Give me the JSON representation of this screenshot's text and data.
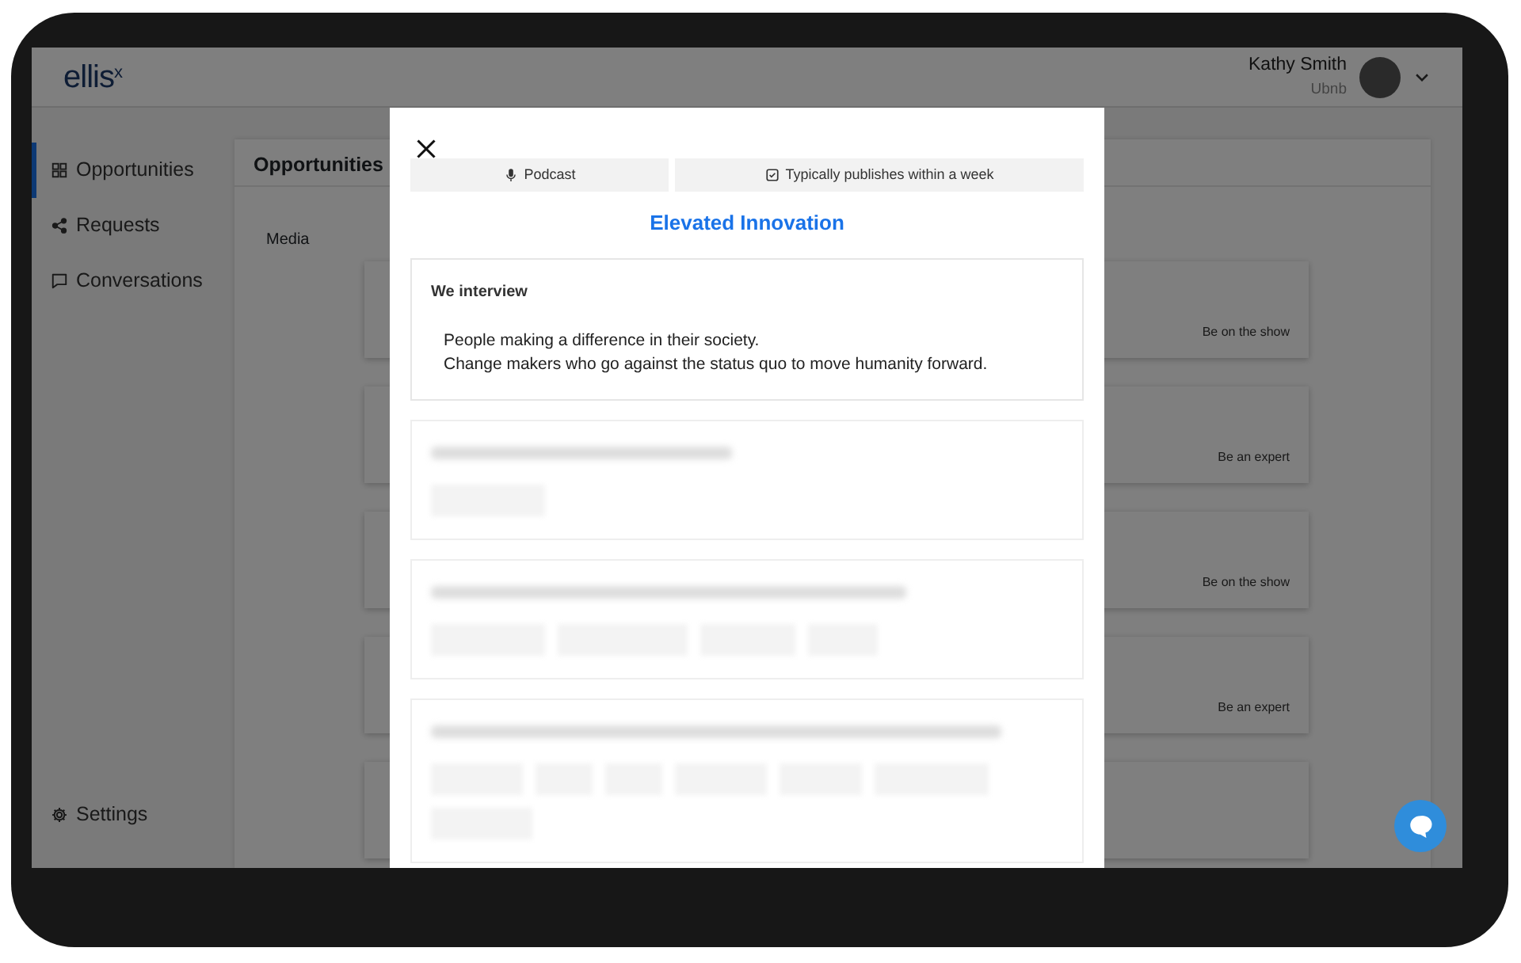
{
  "header": {
    "logo": "ellis",
    "logo_mark": "x",
    "user_name": "Kathy Smith",
    "user_org": "Ubnb"
  },
  "sidebar": {
    "items": [
      {
        "label": "Opportunities",
        "selected": true
      },
      {
        "label": "Requests",
        "selected": false
      },
      {
        "label": "Conversations",
        "selected": false
      }
    ],
    "footer_item": {
      "label": "Settings"
    }
  },
  "main": {
    "title": "Opportunities",
    "section": "Media",
    "cards": [
      {
        "action": "Be on the show"
      },
      {
        "action": "Be an expert"
      },
      {
        "action": "Be on the show"
      },
      {
        "action": "Be an expert"
      }
    ]
  },
  "modal": {
    "tags": [
      {
        "label": "Podcast"
      },
      {
        "label": "Typically publishes within a week"
      }
    ],
    "title": "Elevated Innovation",
    "sections": [
      {
        "heading": "We interview",
        "lines": [
          "People making a difference in their society.",
          "Change makers who go against the status quo to move humanity forward."
        ]
      }
    ]
  }
}
